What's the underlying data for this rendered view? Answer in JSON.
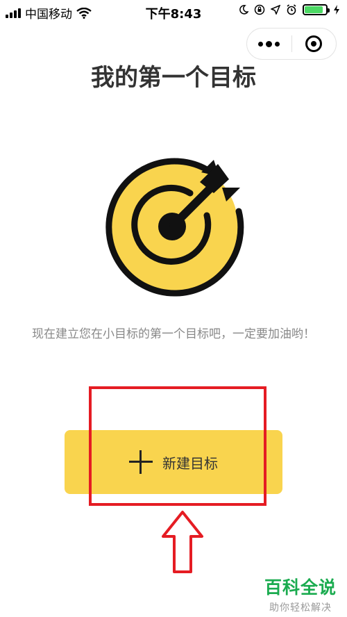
{
  "status_bar": {
    "carrier": "中国移动",
    "time": "下午8:43",
    "battery_level": 0.85
  },
  "capsule": {
    "more_icon": "more-dots-icon",
    "close_icon": "circle-close-icon"
  },
  "page": {
    "title": "我的第一个目标",
    "description": "现在建立您在小目标的第一个目标吧，一定要加油哟！",
    "button_label": "新建目标"
  },
  "colors": {
    "accent_yellow": "#f9d44e",
    "annotation_red": "#e51c23",
    "watermark_green": "#1aab4f"
  },
  "watermark": {
    "main": "百科全说",
    "sub": "助你轻松解决"
  }
}
